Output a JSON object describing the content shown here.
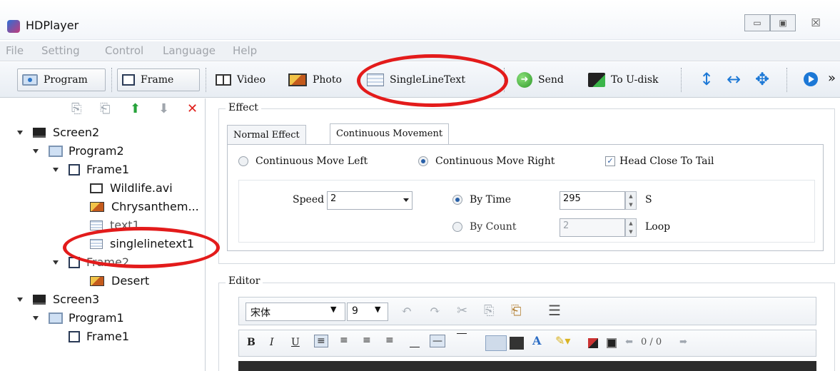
{
  "window": {
    "title": "HDPlayer",
    "minimize": "▭",
    "maximize": "▣",
    "close": "☒"
  },
  "menu": [
    "File",
    "Setting",
    "Control",
    "Language",
    "Help"
  ],
  "toolbar": {
    "program": "Program",
    "frame": "Frame",
    "video": "Video",
    "photo": "Photo",
    "single_line_text": "SingleLineText",
    "send": "Send",
    "to_udisk": "To U-disk",
    "more": "»"
  },
  "tree": {
    "tools": {
      "copy": "⎘",
      "paste": "⎗",
      "up": "⬆",
      "down": "⬇",
      "delete": "✕"
    },
    "items": [
      {
        "label": "Screen2"
      },
      {
        "label": "Program2"
      },
      {
        "label": "Frame1"
      },
      {
        "label": "Wildlife.avi"
      },
      {
        "label": "Chrysanthem..."
      },
      {
        "label": "text1"
      },
      {
        "label": "singlelinetext1"
      },
      {
        "label": "Frame2"
      },
      {
        "label": "Desert"
      },
      {
        "label": "Screen3"
      },
      {
        "label": "Program1"
      },
      {
        "label": "Frame1"
      }
    ]
  },
  "effect": {
    "group_title": "Effect",
    "tabs": [
      "Normal Effect",
      "Continuous Movement"
    ],
    "move_left": "Continuous Move Left",
    "move_right": "Continuous Move Right",
    "head_close": "Head Close To Tail",
    "speed_label": "Speed",
    "speed_value": "2",
    "by_time": "By Time",
    "time_value": "295",
    "time_unit": "S",
    "by_count": "By Count",
    "count_value": "2",
    "count_unit": "Loop"
  },
  "editor": {
    "group_title": "Editor",
    "font_name": "宋体",
    "font_size": "9",
    "bold": "B",
    "italic": "I",
    "underline": "U",
    "page_indicator": "0 / 0"
  }
}
